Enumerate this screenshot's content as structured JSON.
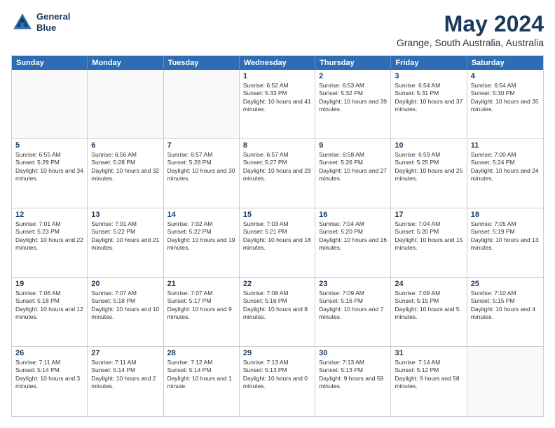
{
  "logo": {
    "line1": "General",
    "line2": "Blue"
  },
  "title": "May 2024",
  "location": "Grange, South Australia, Australia",
  "header_days": [
    "Sunday",
    "Monday",
    "Tuesday",
    "Wednesday",
    "Thursday",
    "Friday",
    "Saturday"
  ],
  "weeks": [
    [
      {
        "day": "",
        "sunrise": "",
        "sunset": "",
        "daylight": "",
        "empty": true
      },
      {
        "day": "",
        "sunrise": "",
        "sunset": "",
        "daylight": "",
        "empty": true
      },
      {
        "day": "",
        "sunrise": "",
        "sunset": "",
        "daylight": "",
        "empty": true
      },
      {
        "day": "1",
        "sunrise": "Sunrise: 6:52 AM",
        "sunset": "Sunset: 5:33 PM",
        "daylight": "Daylight: 10 hours and 41 minutes."
      },
      {
        "day": "2",
        "sunrise": "Sunrise: 6:53 AM",
        "sunset": "Sunset: 5:32 PM",
        "daylight": "Daylight: 10 hours and 39 minutes."
      },
      {
        "day": "3",
        "sunrise": "Sunrise: 6:54 AM",
        "sunset": "Sunset: 5:31 PM",
        "daylight": "Daylight: 10 hours and 37 minutes."
      },
      {
        "day": "4",
        "sunrise": "Sunrise: 6:54 AM",
        "sunset": "Sunset: 5:30 PM",
        "daylight": "Daylight: 10 hours and 35 minutes."
      }
    ],
    [
      {
        "day": "5",
        "sunrise": "Sunrise: 6:55 AM",
        "sunset": "Sunset: 5:29 PM",
        "daylight": "Daylight: 10 hours and 34 minutes."
      },
      {
        "day": "6",
        "sunrise": "Sunrise: 6:56 AM",
        "sunset": "Sunset: 5:28 PM",
        "daylight": "Daylight: 10 hours and 32 minutes."
      },
      {
        "day": "7",
        "sunrise": "Sunrise: 6:57 AM",
        "sunset": "Sunset: 5:28 PM",
        "daylight": "Daylight: 10 hours and 30 minutes."
      },
      {
        "day": "8",
        "sunrise": "Sunrise: 6:57 AM",
        "sunset": "Sunset: 5:27 PM",
        "daylight": "Daylight: 10 hours and 29 minutes."
      },
      {
        "day": "9",
        "sunrise": "Sunrise: 6:58 AM",
        "sunset": "Sunset: 5:26 PM",
        "daylight": "Daylight: 10 hours and 27 minutes."
      },
      {
        "day": "10",
        "sunrise": "Sunrise: 6:59 AM",
        "sunset": "Sunset: 5:25 PM",
        "daylight": "Daylight: 10 hours and 25 minutes."
      },
      {
        "day": "11",
        "sunrise": "Sunrise: 7:00 AM",
        "sunset": "Sunset: 5:24 PM",
        "daylight": "Daylight: 10 hours and 24 minutes."
      }
    ],
    [
      {
        "day": "12",
        "sunrise": "Sunrise: 7:01 AM",
        "sunset": "Sunset: 5:23 PM",
        "daylight": "Daylight: 10 hours and 22 minutes."
      },
      {
        "day": "13",
        "sunrise": "Sunrise: 7:01 AM",
        "sunset": "Sunset: 5:22 PM",
        "daylight": "Daylight: 10 hours and 21 minutes."
      },
      {
        "day": "14",
        "sunrise": "Sunrise: 7:02 AM",
        "sunset": "Sunset: 5:22 PM",
        "daylight": "Daylight: 10 hours and 19 minutes."
      },
      {
        "day": "15",
        "sunrise": "Sunrise: 7:03 AM",
        "sunset": "Sunset: 5:21 PM",
        "daylight": "Daylight: 10 hours and 18 minutes."
      },
      {
        "day": "16",
        "sunrise": "Sunrise: 7:04 AM",
        "sunset": "Sunset: 5:20 PM",
        "daylight": "Daylight: 10 hours and 16 minutes."
      },
      {
        "day": "17",
        "sunrise": "Sunrise: 7:04 AM",
        "sunset": "Sunset: 5:20 PM",
        "daylight": "Daylight: 10 hours and 15 minutes."
      },
      {
        "day": "18",
        "sunrise": "Sunrise: 7:05 AM",
        "sunset": "Sunset: 5:19 PM",
        "daylight": "Daylight: 10 hours and 13 minutes."
      }
    ],
    [
      {
        "day": "19",
        "sunrise": "Sunrise: 7:06 AM",
        "sunset": "Sunset: 5:18 PM",
        "daylight": "Daylight: 10 hours and 12 minutes."
      },
      {
        "day": "20",
        "sunrise": "Sunrise: 7:07 AM",
        "sunset": "Sunset: 5:18 PM",
        "daylight": "Daylight: 10 hours and 10 minutes."
      },
      {
        "day": "21",
        "sunrise": "Sunrise: 7:07 AM",
        "sunset": "Sunset: 5:17 PM",
        "daylight": "Daylight: 10 hours and 9 minutes."
      },
      {
        "day": "22",
        "sunrise": "Sunrise: 7:08 AM",
        "sunset": "Sunset: 5:16 PM",
        "daylight": "Daylight: 10 hours and 8 minutes."
      },
      {
        "day": "23",
        "sunrise": "Sunrise: 7:09 AM",
        "sunset": "Sunset: 5:16 PM",
        "daylight": "Daylight: 10 hours and 7 minutes."
      },
      {
        "day": "24",
        "sunrise": "Sunrise: 7:09 AM",
        "sunset": "Sunset: 5:15 PM",
        "daylight": "Daylight: 10 hours and 5 minutes."
      },
      {
        "day": "25",
        "sunrise": "Sunrise: 7:10 AM",
        "sunset": "Sunset: 5:15 PM",
        "daylight": "Daylight: 10 hours and 4 minutes."
      }
    ],
    [
      {
        "day": "26",
        "sunrise": "Sunrise: 7:11 AM",
        "sunset": "Sunset: 5:14 PM",
        "daylight": "Daylight: 10 hours and 3 minutes."
      },
      {
        "day": "27",
        "sunrise": "Sunrise: 7:11 AM",
        "sunset": "Sunset: 5:14 PM",
        "daylight": "Daylight: 10 hours and 2 minutes."
      },
      {
        "day": "28",
        "sunrise": "Sunrise: 7:12 AM",
        "sunset": "Sunset: 5:14 PM",
        "daylight": "Daylight: 10 hours and 1 minute."
      },
      {
        "day": "29",
        "sunrise": "Sunrise: 7:13 AM",
        "sunset": "Sunset: 5:13 PM",
        "daylight": "Daylight: 10 hours and 0 minutes."
      },
      {
        "day": "30",
        "sunrise": "Sunrise: 7:13 AM",
        "sunset": "Sunset: 5:13 PM",
        "daylight": "Daylight: 9 hours and 59 minutes."
      },
      {
        "day": "31",
        "sunrise": "Sunrise: 7:14 AM",
        "sunset": "Sunset: 5:12 PM",
        "daylight": "Daylight: 9 hours and 58 minutes."
      },
      {
        "day": "",
        "sunrise": "",
        "sunset": "",
        "daylight": "",
        "empty": true
      }
    ]
  ]
}
